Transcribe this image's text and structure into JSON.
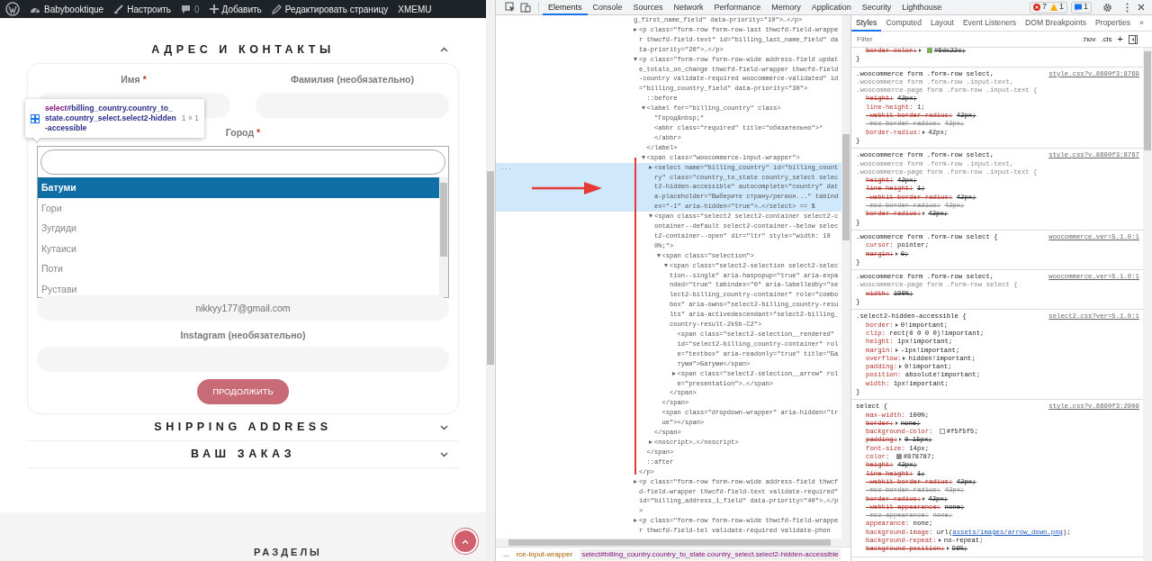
{
  "admin_bar": {
    "items": [
      {
        "kind": "logo"
      },
      {
        "kind": "site",
        "label": "Babybooktique"
      },
      {
        "kind": "customize",
        "label": "Настроить"
      },
      {
        "kind": "comments",
        "label": "0"
      },
      {
        "kind": "new",
        "label": "Добавить"
      },
      {
        "kind": "edit",
        "label": "Редактировать страницу"
      },
      {
        "kind": "text",
        "label": "XMEMU"
      }
    ]
  },
  "checkout": {
    "sections": [
      {
        "title": "АДРЕС И КОНТАКТЫ",
        "expanded": true
      },
      {
        "title": "SHIPPING ADDRESS",
        "expanded": false
      },
      {
        "title": "ВАШ ЗАКАЗ",
        "expanded": false
      }
    ],
    "form": {
      "first_name": {
        "label": "Имя",
        "required_mark": "*"
      },
      "last_name": {
        "label": "Фамилия (необязательно)"
      },
      "city": {
        "label": "Город",
        "required_mark": "*",
        "options": [
          {
            "label": "Батуми",
            "selected": true
          },
          {
            "label": "Гори",
            "selected": false
          },
          {
            "label": "Зугдиди",
            "selected": false
          },
          {
            "label": "Кутаиси",
            "selected": false
          },
          {
            "label": "Поти",
            "selected": false
          },
          {
            "label": "Рустави",
            "selected": false
          }
        ]
      },
      "email": {
        "value": "nikkyy177@gmail.com"
      },
      "instagram": {
        "label": "Instagram (необязательно)"
      },
      "submit": "ПРОДОЛЖИТЬ"
    }
  },
  "inspect_tooltip": {
    "tag": "select",
    "selector": "#billing_country.country_to_state.country_select.select2-hidden-accessible",
    "size": "1 × 1"
  },
  "footer": {
    "heading": "РАЗДЕЛЫ"
  },
  "devtools": {
    "tabs": [
      {
        "label": "Elements",
        "selected": true
      },
      {
        "label": "Console",
        "selected": false
      },
      {
        "label": "Sources",
        "selected": false
      },
      {
        "label": "Network",
        "selected": false
      },
      {
        "label": "Performance",
        "selected": false
      },
      {
        "label": "Memory",
        "selected": false
      },
      {
        "label": "Application",
        "selected": false
      },
      {
        "label": "Security",
        "selected": false
      },
      {
        "label": "Lighthouse",
        "selected": false
      }
    ],
    "counters": [
      {
        "kind": "error",
        "count": "7"
      },
      {
        "kind": "warning",
        "count": "1"
      },
      {
        "kind": "message",
        "count": "1"
      }
    ],
    "dom_tree": [
      {
        "kind": "fragment",
        "text": "g_first_name_field\" data-priority=\"10\">…</p>",
        "selected": false
      },
      {
        "text": "<p class=\"form-row form-row-last thwcfd-field-wrapper thwcfd-field-text\" id=\"billing_last_name_field\" data-priority=\"20\">…</p>",
        "expanded": false,
        "selected": false
      },
      {
        "text": "<p class=\"form-row form-row-wide address-field update_totals_on_change thwcfd-field-wrapper thwcfd-field-country validate-required woocommerce-validated\" id=\"billing_country_field\" data-priority=\"30\">",
        "expanded": true,
        "selected": false,
        "close": "</p>",
        "children": [
          {
            "text": "::before",
            "selected": false
          },
          {
            "text": "<label for=\"billing_country\" class>",
            "expanded": true,
            "selected": false,
            "close": "</label>",
            "children": [
              {
                "text": "\"Город&nbsp;\"",
                "selected": false
              },
              {
                "text": "<abbr class=\"required\" title=\"обязательно\">*",
                "selected": false
              },
              {
                "text": "</abbr>",
                "selected": false
              }
            ]
          },
          {
            "text": "<span class=\"woocommerce-input-wrapper\">",
            "expanded": true,
            "selected": false,
            "close": "</span>",
            "children": [
              {
                "text": "<select name=\"billing_country\" id=\"billing_country\" class=\"country_to_state country_select select2-hidden-accessible\" autocomplete=\"country\" data-placeholder=\"Выберите страну/регион...\" tabindex=\"-1\" aria-hidden=\"true\">…</select> == $",
                "expanded": false,
                "selected": true,
                "gutter": "..."
              },
              {
                "text": "<span class=\"select2 select2-container select2-container--default select2-container--below select2-container--open\" dir=\"ltr\" style=\"width: 100%;\">",
                "expanded": true,
                "selected": false,
                "close": "</span>",
                "children": [
                  {
                    "text": "<span class=\"selection\">",
                    "expanded": true,
                    "selected": false,
                    "close": "</span>",
                    "children": [
                      {
                        "text": "<span class=\"select2-selection select2-selection--single\" aria-haspopup=\"true\" aria-expanded=\"true\" tabindex=\"0\" aria-labelledby=\"select2-billing_country-container\" role=\"combobox\" aria-owns=\"select2-billing_country-results\" aria-activedescendant=\"select2-billing_country-result-2k5b-C2\">",
                        "expanded": true,
                        "selected": false,
                        "close": "</span>",
                        "children": [
                          {
                            "text": "<span class=\"select2-selection__rendered\" id=\"select2-billing_country-container\" role=\"textbox\" aria-readonly=\"true\" title=\"Батуми\">Батуми</span>",
                            "selected": false
                          },
                          {
                            "text": "<span class=\"select2-selection__arrow\" role=\"presentation\">…</span>",
                            "expanded": false,
                            "selected": false
                          }
                        ]
                      }
                    ]
                  },
                  {
                    "text": "<span class=\"dropdown-wrapper\" aria-hidden=\"true\"></span>",
                    "selected": false
                  }
                ]
              },
              {
                "text": "<noscript>…</noscript>",
                "expanded": false,
                "selected": false
              }
            ]
          },
          {
            "text": "::after",
            "selected": false
          }
        ]
      },
      {
        "text": "<p class=\"form-row form-row-wide address-field thwcfd-field-wrapper thwcfd-field-text validate-required\" id=\"billing_address_1_field\" data-priority=\"40\">…</p>",
        "expanded": false,
        "selected": false
      },
      {
        "text": "<p class=\"form-row form-row-wide thwcfd-field-wrapper thwcfd-field-tel validate-required validate-phon",
        "expanded": false,
        "selected": false
      }
    ],
    "breadcrumbs": {
      "overflow": "...",
      "items": [
        {
          "text": "rce-input-wrapper",
          "selected": false
        },
        {
          "text": "select#billing_country.country_to_state.country_select.select2-hidden-accessible",
          "selected": true
        }
      ]
    },
    "styles": {
      "tabs": [
        {
          "label": "Styles",
          "selected": true
        },
        {
          "label": "Computed",
          "selected": false
        },
        {
          "label": "Layout",
          "selected": false
        },
        {
          "label": "Event Listeners",
          "selected": false
        },
        {
          "label": "DOM Breakpoints",
          "selected": false
        },
        {
          "label": "Properties",
          "selected": false
        },
        {
          "label": "»",
          "selected": false
        }
      ],
      "filter_placeholder": "Filter",
      "hov": ":hov",
      "cls": ".cls",
      "add": "+",
      "rules": [
        {
          "declarations": [
            {
              "prop": "border-color:",
              "value": "#6dc22c;",
              "overridden": true,
              "invalid": false,
              "expandable": true,
              "color": "#6dc22c"
            }
          ],
          "close": "}"
        },
        {
          "selector": [
            {
              "text": ".woocommerce form .form-row select,",
              "matched": true
            },
            {
              "text": ".woocommerce form .form-row .input-text, .woocommerce-page form .form-row .input-text {",
              "matched": false
            }
          ],
          "source": "style.css?v…8690f3:8769",
          "declarations": [
            {
              "prop": "height:",
              "value": "42px;",
              "overridden": true,
              "invalid": false
            },
            {
              "prop": "line-height:",
              "value": "1;",
              "overridden": false,
              "invalid": false
            },
            {
              "prop": "-webkit-border-radius:",
              "value": "42px;",
              "overridden": true,
              "invalid": false
            },
            {
              "prop": "-moz-border-radius:",
              "value": "42px;",
              "overridden": false,
              "invalid": true
            },
            {
              "prop": "border-radius:",
              "value": "42px;",
              "overridden": false,
              "invalid": false,
              "expandable": true
            }
          ],
          "close": "}"
        },
        {
          "selector": [
            {
              "text": ".woocommerce form .form-row select,",
              "matched": true
            },
            {
              "text": ".woocommerce form .form-row .input-text, .woocommerce-page form .form-row .input-text {",
              "matched": false
            }
          ],
          "source": "style.css?v…8690f3:8767",
          "declarations": [
            {
              "prop": "height:",
              "value": "42px;",
              "overridden": true,
              "invalid": false
            },
            {
              "prop": "line-height:",
              "value": "1;",
              "overridden": true,
              "invalid": false
            },
            {
              "prop": "-webkit-border-radius:",
              "value": "42px;",
              "overridden": true,
              "invalid": false
            },
            {
              "prop": "-moz-border-radius:",
              "value": "42px;",
              "overridden": false,
              "invalid": true
            },
            {
              "prop": "border-radius:",
              "value": "42px;",
              "overridden": true,
              "invalid": false,
              "expandable": true
            }
          ],
          "close": "}"
        },
        {
          "selector": [
            {
              "text": ".woocommerce form .form-row select {",
              "matched": true
            }
          ],
          "source": "woocommerce…ver=5.1.0:1",
          "declarations": [
            {
              "prop": "cursor:",
              "value": "pointer;",
              "overridden": false,
              "invalid": false
            },
            {
              "prop": "margin:",
              "value": "0;",
              "overridden": true,
              "invalid": false,
              "expandable": true
            }
          ],
          "close": "}"
        },
        {
          "selector": [
            {
              "text": ".woocommerce form .form-row select,",
              "matched": true
            },
            {
              "text": ".woocommerce-page form .form-row select {",
              "matched": false
            }
          ],
          "source": "woocommerce…ver=5.1.0:1",
          "declarations": [
            {
              "prop": "width:",
              "value": "100%;",
              "overridden": true,
              "invalid": false
            }
          ],
          "close": "}"
        },
        {
          "selector": [
            {
              "text": ".select2-hidden-accessible {",
              "matched": true
            }
          ],
          "source": "select2.css?ver=5.1.0:1",
          "declarations": [
            {
              "prop": "border:",
              "value": "0!important;",
              "overridden": false,
              "invalid": false,
              "expandable": true
            },
            {
              "prop": "clip:",
              "value": "rect(0 0 0 0)!important;",
              "overridden": false,
              "invalid": false
            },
            {
              "prop": "height:",
              "value": "1px!important;",
              "overridden": false,
              "invalid": false
            },
            {
              "prop": "margin:",
              "value": "-1px!important;",
              "overridden": false,
              "invalid": false,
              "expandable": true
            },
            {
              "prop": "overflow:",
              "value": "hidden!important;",
              "overridden": false,
              "invalid": false,
              "expandable": true
            },
            {
              "prop": "padding:",
              "value": "0!important;",
              "overridden": false,
              "invalid": false,
              "expandable": true
            },
            {
              "prop": "position:",
              "value": "absolute!important;",
              "overridden": false,
              "invalid": false
            },
            {
              "prop": "width:",
              "value": "1px!important;",
              "overridden": false,
              "invalid": false
            }
          ],
          "close": "}"
        },
        {
          "selector": [
            {
              "text": "select {",
              "matched": true
            }
          ],
          "source": "style.css?v…8690f3:2909",
          "declarations": [
            {
              "prop": "max-width:",
              "value": "100%;",
              "overridden": false,
              "invalid": false
            },
            {
              "prop": "border:",
              "value": "none;",
              "overridden": true,
              "invalid": false,
              "expandable": true
            },
            {
              "prop": "background-color:",
              "value": "#f5f5f5;",
              "overridden": false,
              "invalid": false,
              "color": "#f5f5f5"
            },
            {
              "prop": "padding:",
              "value": "0 15px;",
              "overridden": true,
              "invalid": false,
              "expandable": true
            },
            {
              "prop": "font-size:",
              "value": "14px;",
              "overridden": false,
              "invalid": false
            },
            {
              "prop": "color:",
              "value": "#878787;",
              "overridden": false,
              "invalid": false,
              "color": "#878787"
            },
            {
              "prop": "height:",
              "value": "42px;",
              "overridden": true,
              "invalid": false
            },
            {
              "prop": "line-height:",
              "value": "1;",
              "overridden": true,
              "invalid": false
            },
            {
              "prop": "-webkit-border-radius:",
              "value": "42px;",
              "overridden": true,
              "invalid": false
            },
            {
              "prop": "-moz-border-radius:",
              "value": "42px;",
              "overridden": false,
              "invalid": true
            },
            {
              "prop": "border-radius:",
              "value": "42px;",
              "overridden": true,
              "invalid": false,
              "expandable": true
            },
            {
              "prop": "-webkit-appearance:",
              "value": "none;",
              "overridden": true,
              "invalid": false
            },
            {
              "prop": "-moz-appearance:",
              "value": "none;",
              "overridden": false,
              "invalid": true
            },
            {
              "prop": "appearance:",
              "value": "none;",
              "overridden": false,
              "invalid": false
            },
            {
              "prop": "background-image:",
              "value": "url(",
              "link": "assets/images/arrow_down.png",
              "value_end": ");",
              "overridden": false,
              "invalid": false
            },
            {
              "prop": "background-repeat:",
              "value": "no-repeat;",
              "overridden": false,
              "invalid": false,
              "expandable": true
            },
            {
              "prop": "background-position:",
              "value": "98%;",
              "overridden": true,
              "invalid": false,
              "expandable": true
            }
          ]
        }
      ]
    }
  }
}
